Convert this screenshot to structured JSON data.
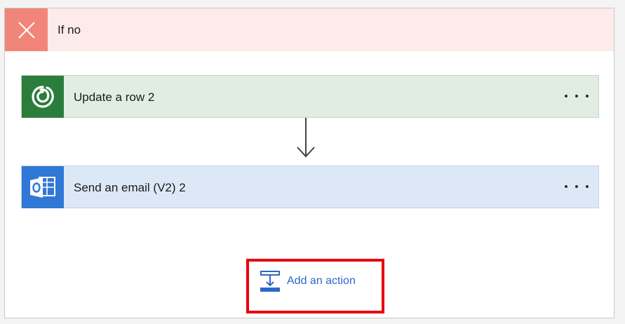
{
  "branch": {
    "title": "If no",
    "header_icon": "close-icon",
    "colors": {
      "header_bg": "#fdebea",
      "header_icon_bg": "#f2857a"
    }
  },
  "actions": [
    {
      "label": "Update a row 2",
      "icon": "dataverse-icon",
      "color": "#2b7d3c",
      "bg": "#e0ede0"
    },
    {
      "label": "Send an email (V2) 2",
      "icon": "outlook-icon",
      "color": "#2f78d6",
      "bg": "#dde8f7"
    }
  ],
  "add_action": {
    "label": "Add an action",
    "icon": "add-action-icon",
    "color": "#2f67c9"
  },
  "highlight_color": "#e8000d"
}
